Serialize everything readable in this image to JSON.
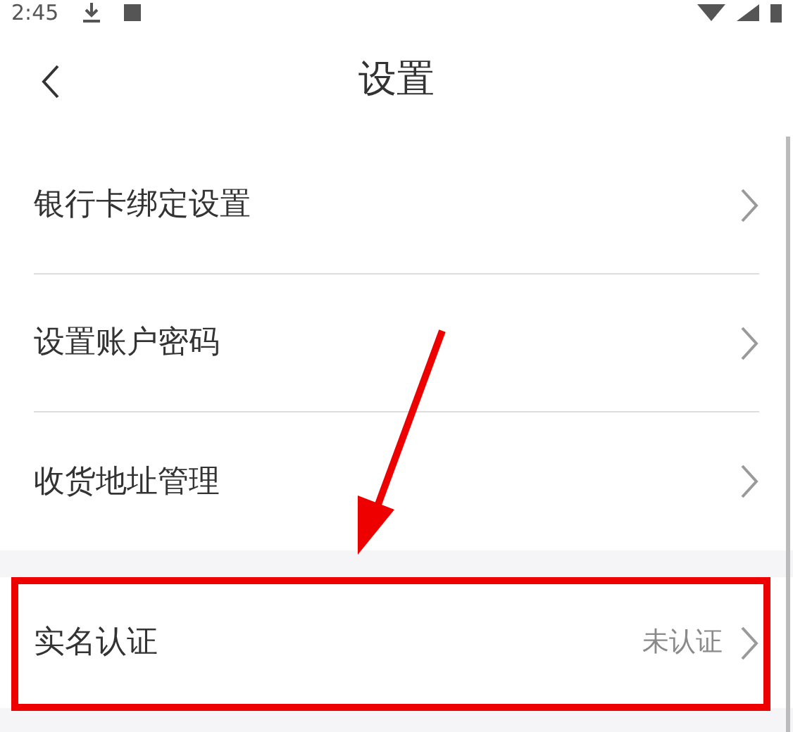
{
  "status_bar": {
    "time": "2:45"
  },
  "header": {
    "title": "设置"
  },
  "groups": [
    {
      "items": [
        {
          "label": "银行卡绑定设置"
        },
        {
          "label": "设置账户密码"
        },
        {
          "label": "收货地址管理"
        }
      ]
    },
    {
      "items": [
        {
          "label": "实名认证",
          "value": "未认证",
          "highlighted": true
        }
      ]
    }
  ]
}
